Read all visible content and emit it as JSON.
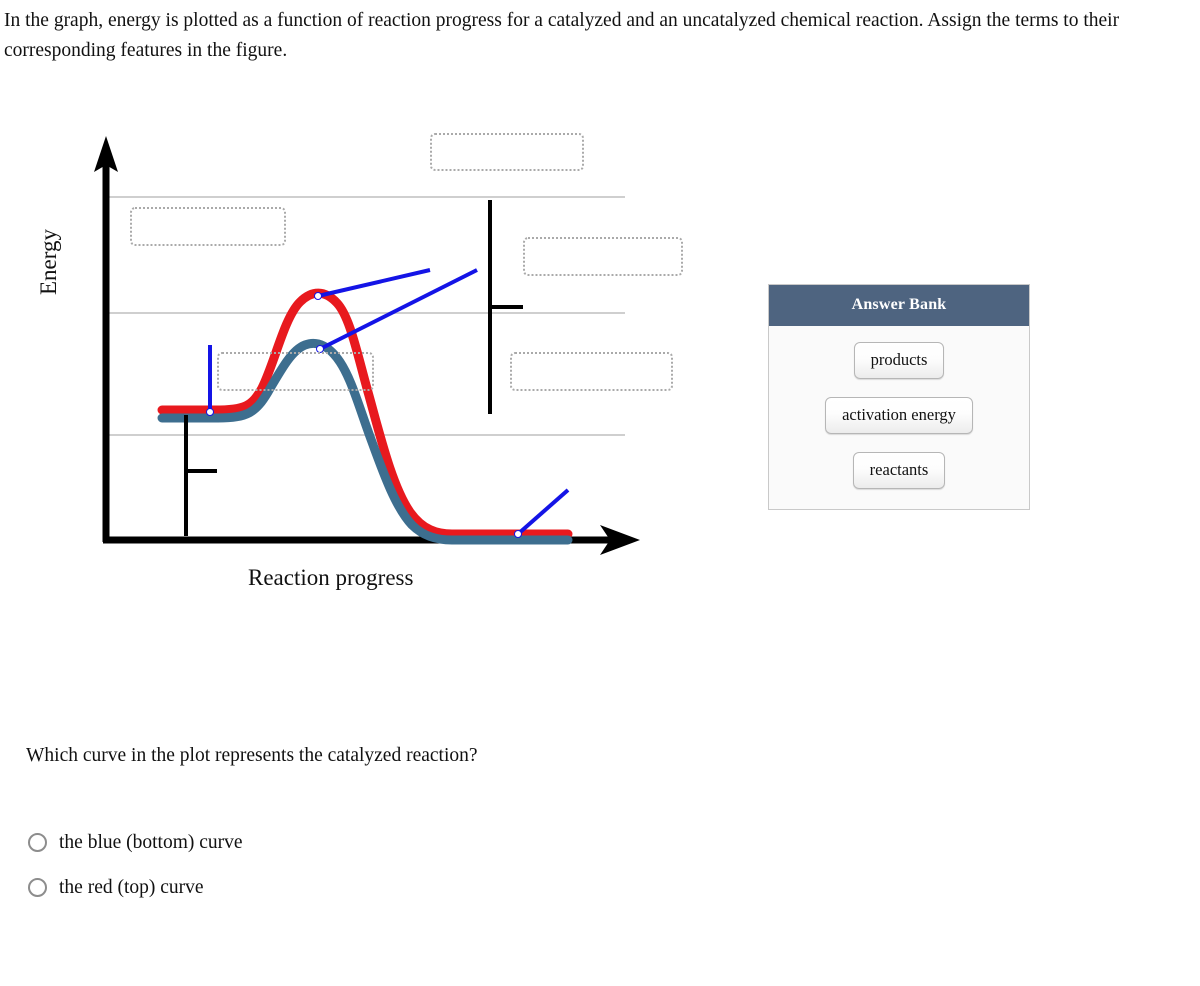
{
  "prompt": "In the graph, energy is plotted as a function of reaction progress for a catalyzed and an uncatalyzed chemical reaction. Assign the terms to their corresponding features in the figure.",
  "figure": {
    "y_axis_label": "Energy",
    "x_axis_label": "Reaction progress",
    "dropzones": [
      {
        "id": "dropzone-reactant-marker",
        "value": ""
      },
      {
        "id": "dropzone-transition-state",
        "value": ""
      },
      {
        "id": "dropzone-activation-energy",
        "value": ""
      },
      {
        "id": "dropzone-reactant-level",
        "value": ""
      },
      {
        "id": "dropzone-product-level",
        "value": ""
      }
    ],
    "colors": {
      "uncatalyzed_curve": "#e8191e",
      "catalyzed_curve": "#3d6e8f",
      "leader_line": "#1414e6",
      "axis": "#000000",
      "gridline": "#cfcfcf",
      "dropzone_border": "#aaaaaa"
    }
  },
  "chart_data": {
    "type": "line",
    "title": "",
    "xlabel": "Reaction progress",
    "ylabel": "Energy",
    "xlim": [
      0,
      1
    ],
    "ylim": [
      0,
      1
    ],
    "grid": true,
    "gridlines_y": [
      0.78,
      0.47,
      0.14
    ],
    "axis_ticks": false,
    "legend": "none",
    "series": [
      {
        "name": "uncatalyzed reaction",
        "color": "#e8191e",
        "position": "top",
        "points": [
          [
            0.03,
            0.47
          ],
          [
            0.1,
            0.47
          ],
          [
            0.17,
            0.47
          ],
          [
            0.24,
            0.48
          ],
          [
            0.3,
            0.55
          ],
          [
            0.36,
            0.68
          ],
          [
            0.42,
            0.77
          ],
          [
            0.47,
            0.78
          ],
          [
            0.52,
            0.74
          ],
          [
            0.58,
            0.62
          ],
          [
            0.64,
            0.42
          ],
          [
            0.7,
            0.24
          ],
          [
            0.76,
            0.16
          ],
          [
            0.83,
            0.145
          ],
          [
            0.92,
            0.145
          ]
        ]
      },
      {
        "name": "catalyzed reaction",
        "color": "#3d6e8f",
        "position": "bottom",
        "points": [
          [
            0.03,
            0.455
          ],
          [
            0.1,
            0.455
          ],
          [
            0.17,
            0.455
          ],
          [
            0.24,
            0.46
          ],
          [
            0.3,
            0.52
          ],
          [
            0.36,
            0.61
          ],
          [
            0.42,
            0.655
          ],
          [
            0.47,
            0.66
          ],
          [
            0.52,
            0.635
          ],
          [
            0.58,
            0.54
          ],
          [
            0.64,
            0.37
          ],
          [
            0.7,
            0.21
          ],
          [
            0.76,
            0.135
          ],
          [
            0.83,
            0.125
          ],
          [
            0.92,
            0.125
          ]
        ]
      }
    ],
    "annotations": [
      {
        "label": "",
        "target": "uncatalyzed transition state peak"
      },
      {
        "label": "",
        "target": "catalyzed transition state peak"
      },
      {
        "label": "",
        "target": "reactant energy level plateau"
      },
      {
        "label": "",
        "target": "product energy level plateau"
      },
      {
        "label": "",
        "target": "activation energy bracket"
      }
    ]
  },
  "answer_bank": {
    "title": "Answer Bank",
    "items": [
      {
        "label": "products"
      },
      {
        "label": "activation energy"
      },
      {
        "label": "reactants"
      }
    ]
  },
  "followup": {
    "question": "Which curve in the plot represents the catalyzed reaction?",
    "choices": [
      {
        "label": "the blue (bottom) curve",
        "selected": false
      },
      {
        "label": "the red (top) curve",
        "selected": false
      }
    ]
  }
}
